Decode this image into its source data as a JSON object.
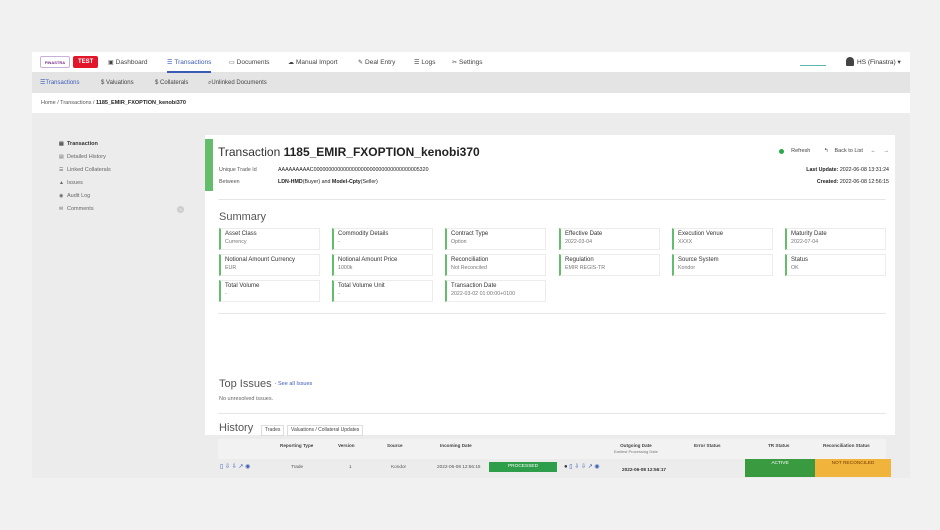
{
  "topnav": {
    "logo_text": "FINASTRA",
    "env_badge": "TEST",
    "items": [
      {
        "label": "Dashboard",
        "icon": "briefcase-icon",
        "glyph": "▣"
      },
      {
        "label": "Transactions",
        "icon": "list-icon",
        "glyph": "☰"
      },
      {
        "label": "Documents",
        "icon": "inbox-icon",
        "glyph": "▭"
      },
      {
        "label": "Manual Import",
        "icon": "cloud-upload-icon",
        "glyph": "☁"
      },
      {
        "label": "Deal Entry",
        "icon": "edit-icon",
        "glyph": "✎"
      },
      {
        "label": "Logs",
        "icon": "list-icon",
        "glyph": "☰"
      },
      {
        "label": "Settings",
        "icon": "wrench-icon",
        "glyph": "✂"
      }
    ],
    "user": "HS (Finastra)"
  },
  "subnav": {
    "items": [
      {
        "label": "Transactions",
        "glyph": "☰"
      },
      {
        "label": "Valuations",
        "glyph": "$"
      },
      {
        "label": "Collaterals",
        "glyph": "$"
      },
      {
        "label": "Unlinked Documents",
        "glyph": "⌕"
      }
    ]
  },
  "breadcrumb": {
    "home": "Home",
    "sep": "/",
    "transactions": "Transactions",
    "current": "1185_EMIR_FXOPTION_kenobi370"
  },
  "sidebar": {
    "items": [
      {
        "label": "Transaction",
        "glyph": "▤"
      },
      {
        "label": "Detailed History",
        "glyph": "▤"
      },
      {
        "label": "Linked Collaterals",
        "glyph": "☰"
      },
      {
        "label": "Issues",
        "glyph": "▲"
      },
      {
        "label": "Audit Log",
        "glyph": "◉"
      },
      {
        "label": "Comments",
        "glyph": "✉",
        "count": "0"
      }
    ]
  },
  "transaction": {
    "title_prefix": "Transaction",
    "title_id": "1185_EMIR_FXOPTION_kenobi370",
    "uti_label": "Unique Trade Id",
    "uti_value": "AAAAAAAAAC000000000000000000000000000000000005320",
    "between_label": "Between",
    "party1": "LDN-HMD",
    "party1_role": "(Buyer)",
    "and_text": "and",
    "party2": "Model-Cpty",
    "party2_role": "(Seller)",
    "refresh": "Refresh",
    "back": "Back to List",
    "prev_glyph": "←",
    "next_glyph": "→",
    "last_update_label": "Last Update:",
    "last_update": "2022-06-08 13:31:24",
    "created_label": "Created:",
    "created": "2022-06-08 12:56:15"
  },
  "summary": {
    "title": "Summary",
    "fields": [
      {
        "label": "Asset Class",
        "value": "Currency"
      },
      {
        "label": "Commodity Details",
        "value": "-"
      },
      {
        "label": "Contract Type",
        "value": "Option"
      },
      {
        "label": "Effective Date",
        "value": "2022-03-04"
      },
      {
        "label": "Execution Venue",
        "value": "XXXX"
      },
      {
        "label": "Maturity Date",
        "value": "2022-07-04"
      },
      {
        "label": "Notional Amount Currency",
        "value": "EUR"
      },
      {
        "label": "Notional Amount Price",
        "value": "1000k"
      },
      {
        "label": "Reconciliation",
        "value": "Not Reconciled"
      },
      {
        "label": "Regulation",
        "value": "EMIR REGIS-TR"
      },
      {
        "label": "Source System",
        "value": "Kondor"
      },
      {
        "label": "Status",
        "value": "OK"
      },
      {
        "label": "Total Volume",
        "value": "-"
      },
      {
        "label": "Total Volume Unit",
        "value": "-"
      },
      {
        "label": "Transaction Date",
        "value": "2022-03-02 01:00:00+0100"
      }
    ]
  },
  "issues": {
    "title": "Top Issues",
    "see_all": "- See all Issues",
    "empty": "No unresolved issues."
  },
  "history": {
    "title": "History",
    "tabs": [
      "Trades",
      "Valuations / Collateral Updates"
    ],
    "columns": {
      "reporting_type": "Reporting Type",
      "version": "Version",
      "source": "Source",
      "incoming_date": "Incoming Date",
      "outgoing_date": "Outgoing Date",
      "earliest": "Earliest Processing Date",
      "error_status": "Error Status",
      "tr_status": "TR Status",
      "recon_status": "Reconciliation Status"
    },
    "rows": [
      {
        "reporting_type": "Trade",
        "version": "1",
        "source": "Kondor",
        "incoming_date": "2022-06-08 12:56:15",
        "processing": "PROCESSED",
        "outgoing_date": "2022-06-08 12:56:17",
        "tr_status": "ACTIVE",
        "recon_status": "NOT RECONCILED"
      }
    ]
  },
  "colors": {
    "accent_green": "#63bd6b",
    "brand_blue": "#3b5bb5",
    "processed": "#2f9e4a",
    "active": "#3a9a3f",
    "not_reconciled": "#f0b43c"
  }
}
